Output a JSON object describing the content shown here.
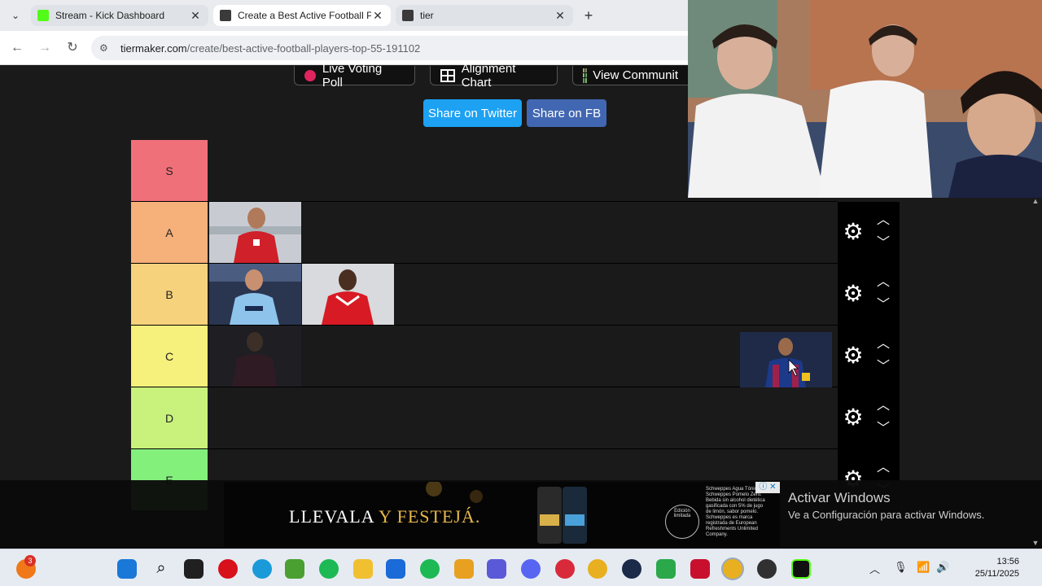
{
  "browser": {
    "tabs": [
      {
        "title": "Stream - Kick Dashboard",
        "active": false,
        "favicon_color": "#53fc18"
      },
      {
        "title": "Create a Best Active Football Pl",
        "active": true,
        "favicon_color": "#333333"
      },
      {
        "title": "tier",
        "active": false,
        "favicon_color": "#333333"
      }
    ],
    "url_host": "tiermaker.com",
    "url_path": "/create/best-active-football-players-top-55-191102"
  },
  "page": {
    "live_voting_label": "Live Voting Poll",
    "alignment_chart_label": "Alignment Chart",
    "view_community_label": "View Communit",
    "share_twitter_label": "Share on Twitter",
    "share_fb_label": "Share on FB"
  },
  "tiers": [
    {
      "label": "S",
      "color": "#ff7f7f",
      "items": 0
    },
    {
      "label": "A",
      "color": "#ffbf7f",
      "items": 1
    },
    {
      "label": "B",
      "color": "#ffdf7f",
      "items": 2
    },
    {
      "label": "C",
      "color": "#ffff7f",
      "items": 1
    },
    {
      "label": "D",
      "color": "#bfff7f",
      "items": 0
    },
    {
      "label": "E",
      "color": "#7fff7f",
      "items": 0
    }
  ],
  "ad": {
    "headline_white": "LLEVALA",
    "headline_gold": "Y FESTEJÁ.",
    "fineprint": "Schweppes Agua Tónica. Schweppes Pomelo Zero. Bebida sin alcohol dietética gasificada con 5% de jugo de limón, sabor pomelo. Schweppes es marca registrada de European Refreshments Unlimited Company.",
    "badge_text": "Edición limitada"
  },
  "windows_watermark": {
    "title": "Activar Windows",
    "subtitle": "Ve a Configuración para activar Windows."
  },
  "taskbar": {
    "notification_count": "3",
    "time": "13:56",
    "date": "25/11/2025"
  }
}
